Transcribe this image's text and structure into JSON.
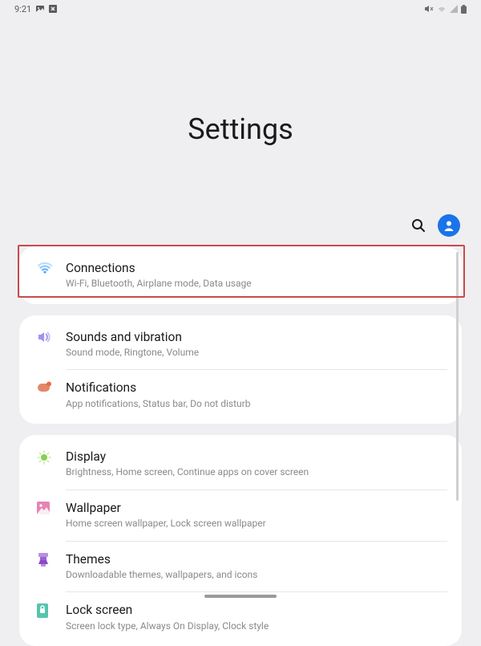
{
  "statusBar": {
    "time": "9:21"
  },
  "pageTitle": "Settings",
  "highlightedIndex": 0,
  "groups": [
    {
      "rows": [
        {
          "id": "connections",
          "title": "Connections",
          "subtitle": "Wi-Fi, Bluetooth, Airplane mode, Data usage",
          "iconColor": "#3b82f6"
        }
      ]
    },
    {
      "rows": [
        {
          "id": "sounds",
          "title": "Sounds and vibration",
          "subtitle": "Sound mode, Ringtone, Volume",
          "iconColor": "#8b7ff0"
        },
        {
          "id": "notifications",
          "title": "Notifications",
          "subtitle": "App notifications, Status bar, Do not disturb",
          "iconColor": "#e07759"
        }
      ]
    },
    {
      "rows": [
        {
          "id": "display",
          "title": "Display",
          "subtitle": "Brightness, Home screen, Continue apps on cover screen",
          "iconColor": "#7cc947"
        },
        {
          "id": "wallpaper",
          "title": "Wallpaper",
          "subtitle": "Home screen wallpaper, Lock screen wallpaper",
          "iconColor": "#e06aa8"
        },
        {
          "id": "themes",
          "title": "Themes",
          "subtitle": "Downloadable themes, wallpapers, and icons",
          "iconColor": "#9b5fd4"
        },
        {
          "id": "lockscreen",
          "title": "Lock screen",
          "subtitle": "Screen lock type, Always On Display, Clock style",
          "iconColor": "#3fb8a0"
        }
      ]
    }
  ]
}
